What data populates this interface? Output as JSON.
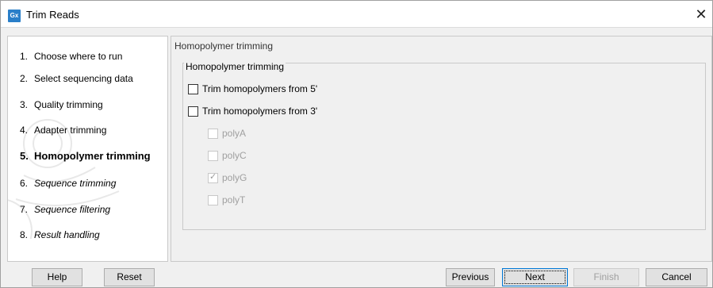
{
  "window": {
    "app_logo_text": "Gx",
    "title": "Trim Reads",
    "close_glyph": "✕"
  },
  "steps": [
    {
      "num": "1.",
      "label": "Choose where to run",
      "state": "done"
    },
    {
      "num": "2.",
      "label": "Select sequencing data",
      "state": "done"
    },
    {
      "num": "3.",
      "label": "Quality trimming",
      "state": "done"
    },
    {
      "num": "4.",
      "label": "Adapter trimming",
      "state": "done"
    },
    {
      "num": "5.",
      "label": "Homopolymer trimming",
      "state": "current"
    },
    {
      "num": "6.",
      "label": "Sequence trimming",
      "state": "future"
    },
    {
      "num": "7.",
      "label": "Sequence filtering",
      "state": "future"
    },
    {
      "num": "8.",
      "label": "Result handling",
      "state": "future"
    }
  ],
  "content": {
    "section_header": "Homopolymer trimming",
    "group_title": "Homopolymer trimming",
    "options": [
      {
        "label": "Trim homopolymers from 5'",
        "checked": false,
        "enabled": true
      },
      {
        "label": "Trim homopolymers from 3'",
        "checked": false,
        "enabled": true
      }
    ],
    "sub_options": [
      {
        "label": "polyA",
        "checked": false,
        "enabled": false
      },
      {
        "label": "polyC",
        "checked": false,
        "enabled": false
      },
      {
        "label": "polyG",
        "checked": true,
        "enabled": false
      },
      {
        "label": "polyT",
        "checked": false,
        "enabled": false
      }
    ]
  },
  "buttons": {
    "help": "Help",
    "reset": "Reset",
    "previous": "Previous",
    "next": "Next",
    "finish": "Finish",
    "cancel": "Cancel"
  },
  "colors": {
    "logo_bg": "#2a7fc9",
    "default_button_border": "#0078d7",
    "disabled_text": "#a0a0a0"
  }
}
